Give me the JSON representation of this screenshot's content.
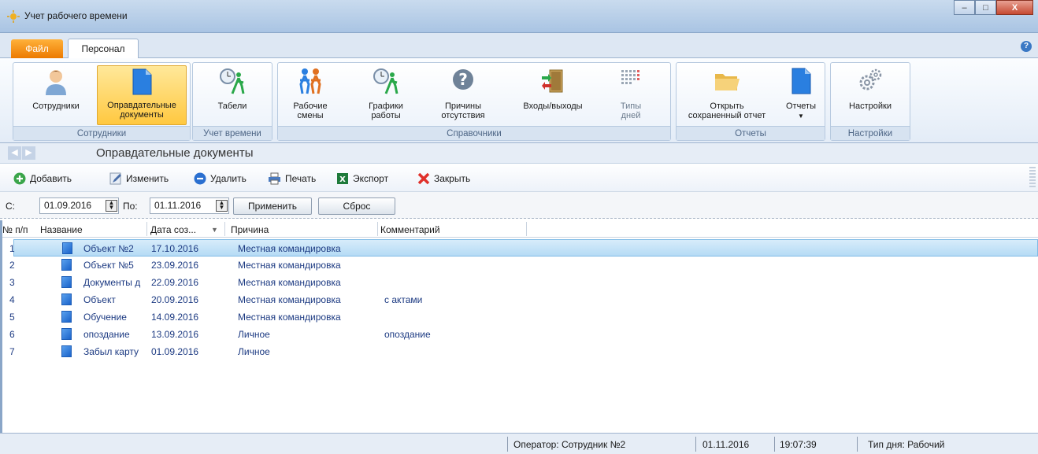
{
  "window": {
    "title": "Учет рабочего времени",
    "minimize": "–",
    "maximize": "□",
    "close": "X"
  },
  "tabs": {
    "file": "Файл",
    "personal": "Персонал"
  },
  "ribbon": {
    "groups": {
      "employees": "Сотрудники",
      "time_tracking": "Учет времени",
      "references": "Справочники",
      "reports": "Отчеты",
      "settings": "Настройки"
    },
    "buttons": {
      "employees": "Сотрудники",
      "justifying_docs_1": "Оправдательные",
      "justifying_docs_2": "документы",
      "timesheets": "Табели",
      "work_shifts_1": "Рабочие",
      "work_shifts_2": "смены",
      "work_schedules_1": "Графики",
      "work_schedules_2": "работы",
      "absence_reasons_1": "Причины",
      "absence_reasons_2": "отсутствия",
      "entries_exits": "Входы/выходы",
      "day_types_1": "Типы",
      "day_types_2": "дней",
      "open_report_1": "Открыть",
      "open_report_2": "сохраненный отчет",
      "reports": "Отчеты",
      "settings": "Настройки"
    }
  },
  "page": {
    "title": "Оправдательные документы"
  },
  "toolbar": {
    "add": "Добавить",
    "edit": "Изменить",
    "delete": "Удалить",
    "print": "Печать",
    "export": "Экспорт",
    "close": "Закрыть"
  },
  "filter": {
    "from_label": "С:",
    "from_value": "01.09.2016",
    "to_label": "По:",
    "to_value": "01.11.2016",
    "apply": "Применить",
    "reset": "Сброс"
  },
  "table": {
    "columns": [
      "№ п/п",
      "Название",
      "Дата соз...",
      "Причина",
      "Комментарий"
    ],
    "sort_indicator": "▼",
    "rows": [
      {
        "n": "1",
        "name": "Объект №2",
        "date": "17.10.2016",
        "reason": "Местная командировка",
        "comment": ""
      },
      {
        "n": "2",
        "name": "Объект №5",
        "date": "23.09.2016",
        "reason": "Местная командировка",
        "comment": ""
      },
      {
        "n": "3",
        "name": "Документы д",
        "date": "22.09.2016",
        "reason": "Местная командировка",
        "comment": ""
      },
      {
        "n": "4",
        "name": "Объект",
        "date": "20.09.2016",
        "reason": "Местная командировка",
        "comment": "с актами"
      },
      {
        "n": "5",
        "name": "Обучение",
        "date": "14.09.2016",
        "reason": "Местная командировка",
        "comment": ""
      },
      {
        "n": "6",
        "name": "опоздание",
        "date": "13.09.2016",
        "reason": "Личное",
        "comment": "опоздание"
      },
      {
        "n": "7",
        "name": "Забыл карту",
        "date": "01.09.2016",
        "reason": "Личное",
        "comment": ""
      }
    ]
  },
  "status": {
    "operator": "Оператор:  Сотрудник №2",
    "date": "01.11.2016",
    "time": "19:07:39",
    "day_type": "Тип дня:  Рабочий"
  },
  "colors": {
    "accent": "#ffc840",
    "selection": "#b5dbf5",
    "link_text": "#1c3a82",
    "file_tab": "#ec7a00"
  }
}
